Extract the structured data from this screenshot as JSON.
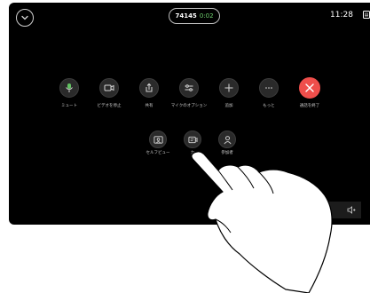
{
  "call": {
    "number": "74145",
    "timer": "0:02"
  },
  "clock": "11:28",
  "controls": {
    "mute": "ミュート",
    "stop_video": "ビデオを停止",
    "share": "共有",
    "mic_options": "マイクのオプション",
    "add": "追加",
    "more": "もっと",
    "end_call": "通話を終了"
  },
  "secondary": {
    "self_view": "セルフビュー",
    "camera": "カ",
    "participants": "参加者"
  },
  "colors": {
    "end_call": "#ef4e4b",
    "timer": "#6fd36f"
  }
}
